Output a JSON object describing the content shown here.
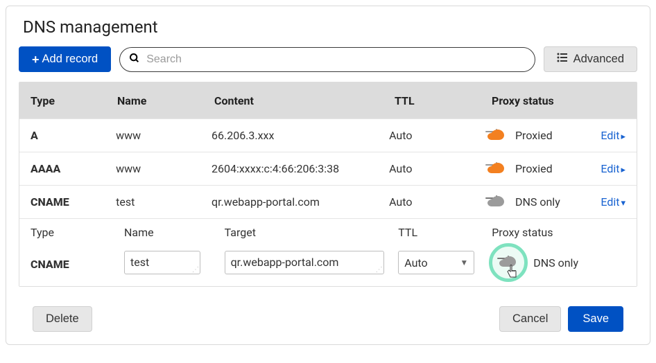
{
  "title": "DNS management",
  "toolbar": {
    "add_label": "Add record",
    "search_placeholder": "Search",
    "advanced_label": "Advanced"
  },
  "columns": {
    "type": "Type",
    "name": "Name",
    "content": "Content",
    "ttl": "TTL",
    "proxy": "Proxy status"
  },
  "rows": [
    {
      "type": "A",
      "name": "www",
      "content": "66.206.3.xxx",
      "ttl": "Auto",
      "proxy": "Proxied",
      "proxy_kind": "orange",
      "edit": "Edit",
      "chev": "▸"
    },
    {
      "type": "AAAA",
      "name": "www",
      "content": "2604:xxxx:c:4:66:206:3:38",
      "ttl": "Auto",
      "proxy": "Proxied",
      "proxy_kind": "orange",
      "edit": "Edit",
      "chev": "▸"
    },
    {
      "type": "CNAME",
      "name": "test",
      "content": "qr.webapp-portal.com",
      "ttl": "Auto",
      "proxy": "DNS only",
      "proxy_kind": "grey",
      "edit": "Edit",
      "chev": "▾"
    }
  ],
  "edit": {
    "labels": {
      "type": "Type",
      "name": "Name",
      "target": "Target",
      "ttl": "TTL",
      "proxy": "Proxy status"
    },
    "type_value": "CNAME",
    "name_value": "test",
    "target_value": "qr.webapp-portal.com",
    "ttl_value": "Auto",
    "proxy_value": "DNS only"
  },
  "footer": {
    "delete": "Delete",
    "cancel": "Cancel",
    "save": "Save"
  }
}
